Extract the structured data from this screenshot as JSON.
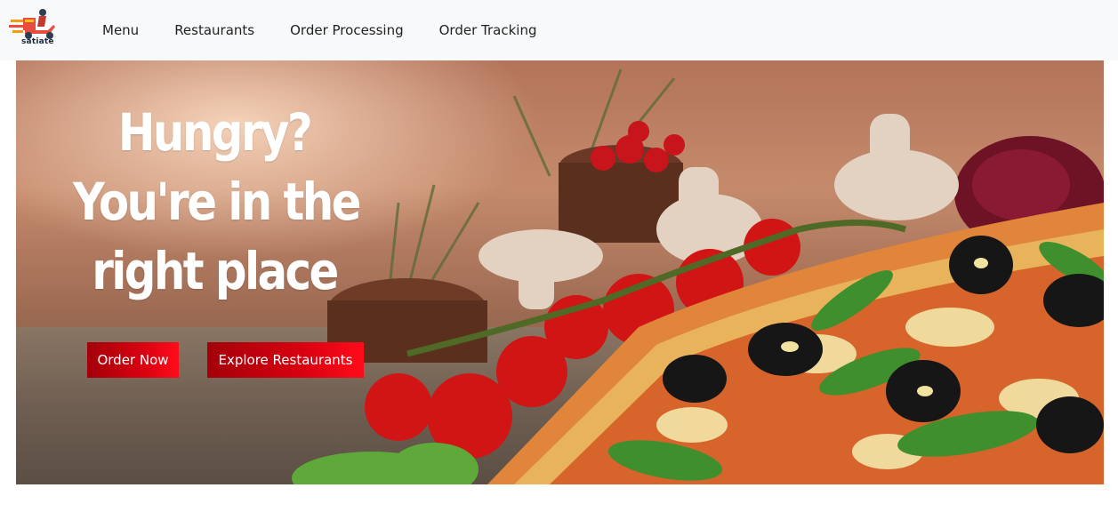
{
  "navbar": {
    "brand_name": "satiate",
    "links": [
      "Menu",
      "Restaurants",
      "Order Processing",
      "Order Tracking"
    ]
  },
  "hero": {
    "headline_lines": [
      "Hungry?",
      "You're in the",
      "right place"
    ],
    "order_button": "Order Now",
    "explore_button": "Explore Restaurants"
  },
  "colors": {
    "navbar_bg": "#f8f9fa",
    "button_red": "#e00012",
    "text_dark": "#222222"
  }
}
